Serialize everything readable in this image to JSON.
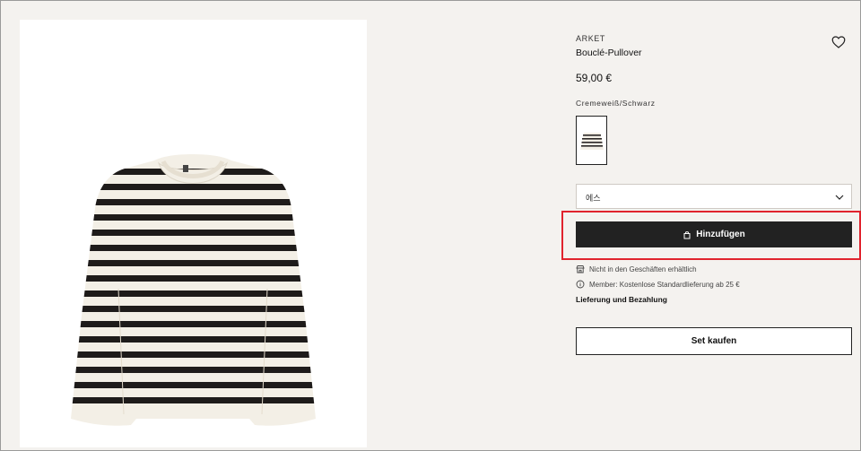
{
  "product": {
    "brand": "ARKET",
    "title": "Bouclé-Pullover",
    "price": "59,00 €",
    "color_name": "Cremeweiß/Schwarz"
  },
  "size_select": {
    "value": "에스"
  },
  "actions": {
    "add_label": "Hinzufügen",
    "set_label": "Set kaufen"
  },
  "info": {
    "not_in_stores": "Nicht in den Geschäften erhältlich",
    "member": "Member: Kostenlose Standardlieferung ab 25 €",
    "delivery_link": "Lieferung und Bezahlung"
  },
  "icons": {
    "wishlist": "heart-icon",
    "size_chevron": "chevron-down-icon",
    "add": "shopping-bag-icon",
    "store": "store-icon",
    "info": "info-icon"
  },
  "colors": {
    "background": "#f4f2ef",
    "button_dark": "#222222",
    "highlight": "#e0232d",
    "stripe": "#1e1b1a",
    "knit": "#f3efe6"
  }
}
